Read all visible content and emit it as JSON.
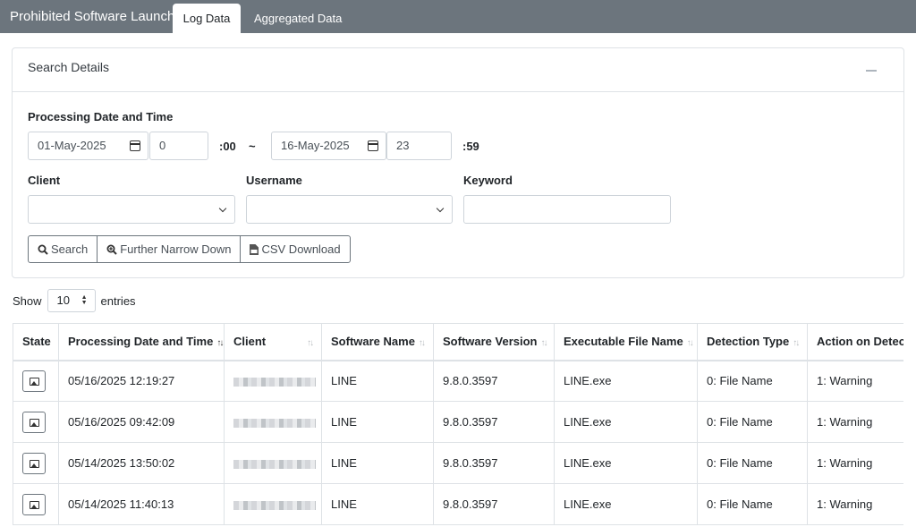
{
  "topbar": {
    "title": "Prohibited Software Launch",
    "tabs": [
      {
        "label": "Log Data",
        "active": true
      },
      {
        "label": "Aggregated Data",
        "active": false
      }
    ]
  },
  "search": {
    "header": "Search Details",
    "processing_label": "Processing Date and Time",
    "from_date": "01-May-2025",
    "from_hour": "0",
    "from_suffix": ":00",
    "range_sep": "~",
    "to_date": "16-May-2025",
    "to_hour": "23",
    "to_suffix": ":59",
    "client_label": "Client",
    "client_value": "",
    "username_label": "Username",
    "username_value": "",
    "keyword_label": "Keyword",
    "keyword_value": "",
    "buttons": {
      "search": "Search",
      "narrow": "Further Narrow Down",
      "csv": "CSV Download"
    }
  },
  "entries": {
    "show_label": "Show",
    "value": "10",
    "entries_label": "entries"
  },
  "table": {
    "columns": [
      "State",
      "Processing Date and Time",
      "Client",
      "Software Name",
      "Software Version",
      "Executable File Name",
      "Detection Type",
      "Action on Detection"
    ],
    "rows": [
      {
        "datetime": "05/16/2025 12:19:27",
        "software": "LINE",
        "version": "9.8.0.3597",
        "exe": "LINE.exe",
        "detection": "0: File Name",
        "action": "1: Warning"
      },
      {
        "datetime": "05/16/2025 09:42:09",
        "software": "LINE",
        "version": "9.8.0.3597",
        "exe": "LINE.exe",
        "detection": "0: File Name",
        "action": "1: Warning"
      },
      {
        "datetime": "05/14/2025 13:50:02",
        "software": "LINE",
        "version": "9.8.0.3597",
        "exe": "LINE.exe",
        "detection": "0: File Name",
        "action": "1: Warning"
      },
      {
        "datetime": "05/14/2025 11:40:13",
        "software": "LINE",
        "version": "9.8.0.3597",
        "exe": "LINE.exe",
        "detection": "0: File Name",
        "action": "1: Warning"
      }
    ]
  }
}
